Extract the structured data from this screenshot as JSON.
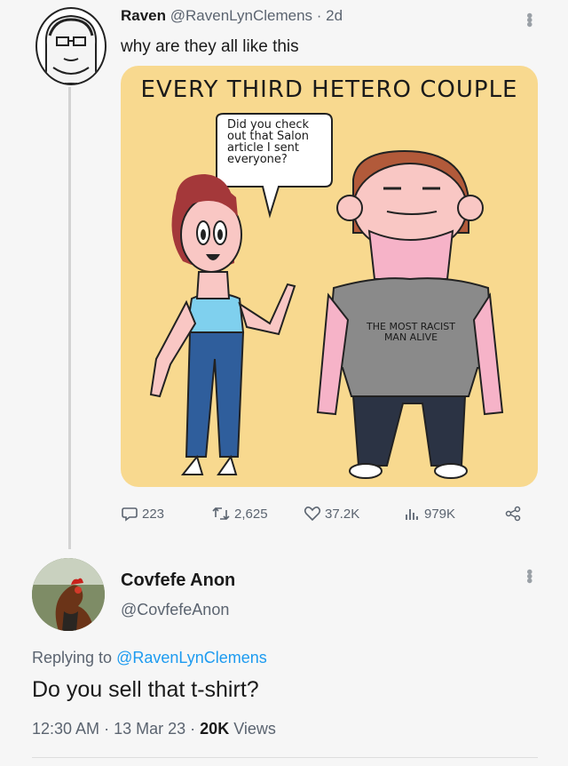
{
  "tweet1": {
    "display_name": "Raven",
    "handle": "@RavenLynClemens",
    "separator": "·",
    "age": "2d",
    "text": "why are they all like this",
    "image": {
      "title": "EVERY THIRD HETERO COUPLE",
      "speech_bubble": [
        "Did you check",
        "out that Salon",
        "article I sent",
        "everyone?"
      ],
      "shirt_text": [
        "THE MOST RACIST",
        "MAN ALIVE"
      ]
    },
    "actions": {
      "replies": "223",
      "retweets": "2,625",
      "likes": "37.2K",
      "views": "979K"
    }
  },
  "reply": {
    "display_name": "Covfefe Anon",
    "handle": "@CovfefeAnon",
    "replying_prefix": "Replying to",
    "replying_to": "@RavenLynClemens",
    "text": "Do you sell that t-shirt?",
    "time": "12:30 AM",
    "date": "13 Mar 23",
    "views_count": "20K",
    "views_label": "Views",
    "separator": "·"
  },
  "colors": {
    "comic_bg": "#f8d98f",
    "link": "#1d9bf0",
    "muted": "#5b6470"
  }
}
